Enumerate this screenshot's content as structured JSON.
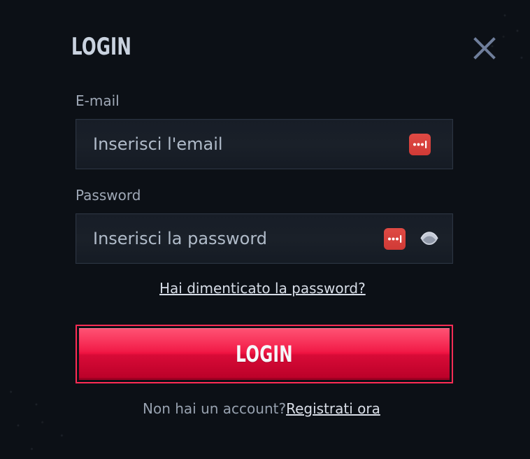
{
  "modal": {
    "title": "LOGIN",
    "close_icon": "close-icon"
  },
  "email": {
    "label": "E-mail",
    "value": "",
    "placeholder": "Inserisci l'email",
    "password_manager_icon": "password-manager-icon"
  },
  "password": {
    "label": "Password",
    "value": "",
    "placeholder": "Inserisci la password",
    "password_manager_icon": "password-manager-icon",
    "visibility_icon": "eye-icon"
  },
  "forgot_password": {
    "label": "Hai dimenticato la password?"
  },
  "actions": {
    "login_label": "LOGIN"
  },
  "register": {
    "prompt": "Non hai un account?",
    "link": "Registrati ora"
  },
  "colors": {
    "background": "#0c1016",
    "input_background": "#191f29",
    "input_border": "#2b3442",
    "text_primary": "#c9d2df",
    "text_muted": "#9fa8b6",
    "accent": "#f01442",
    "accent_border": "#ff2c55",
    "password_manager": "#d94641",
    "close_icon": "#6f7e9b"
  }
}
